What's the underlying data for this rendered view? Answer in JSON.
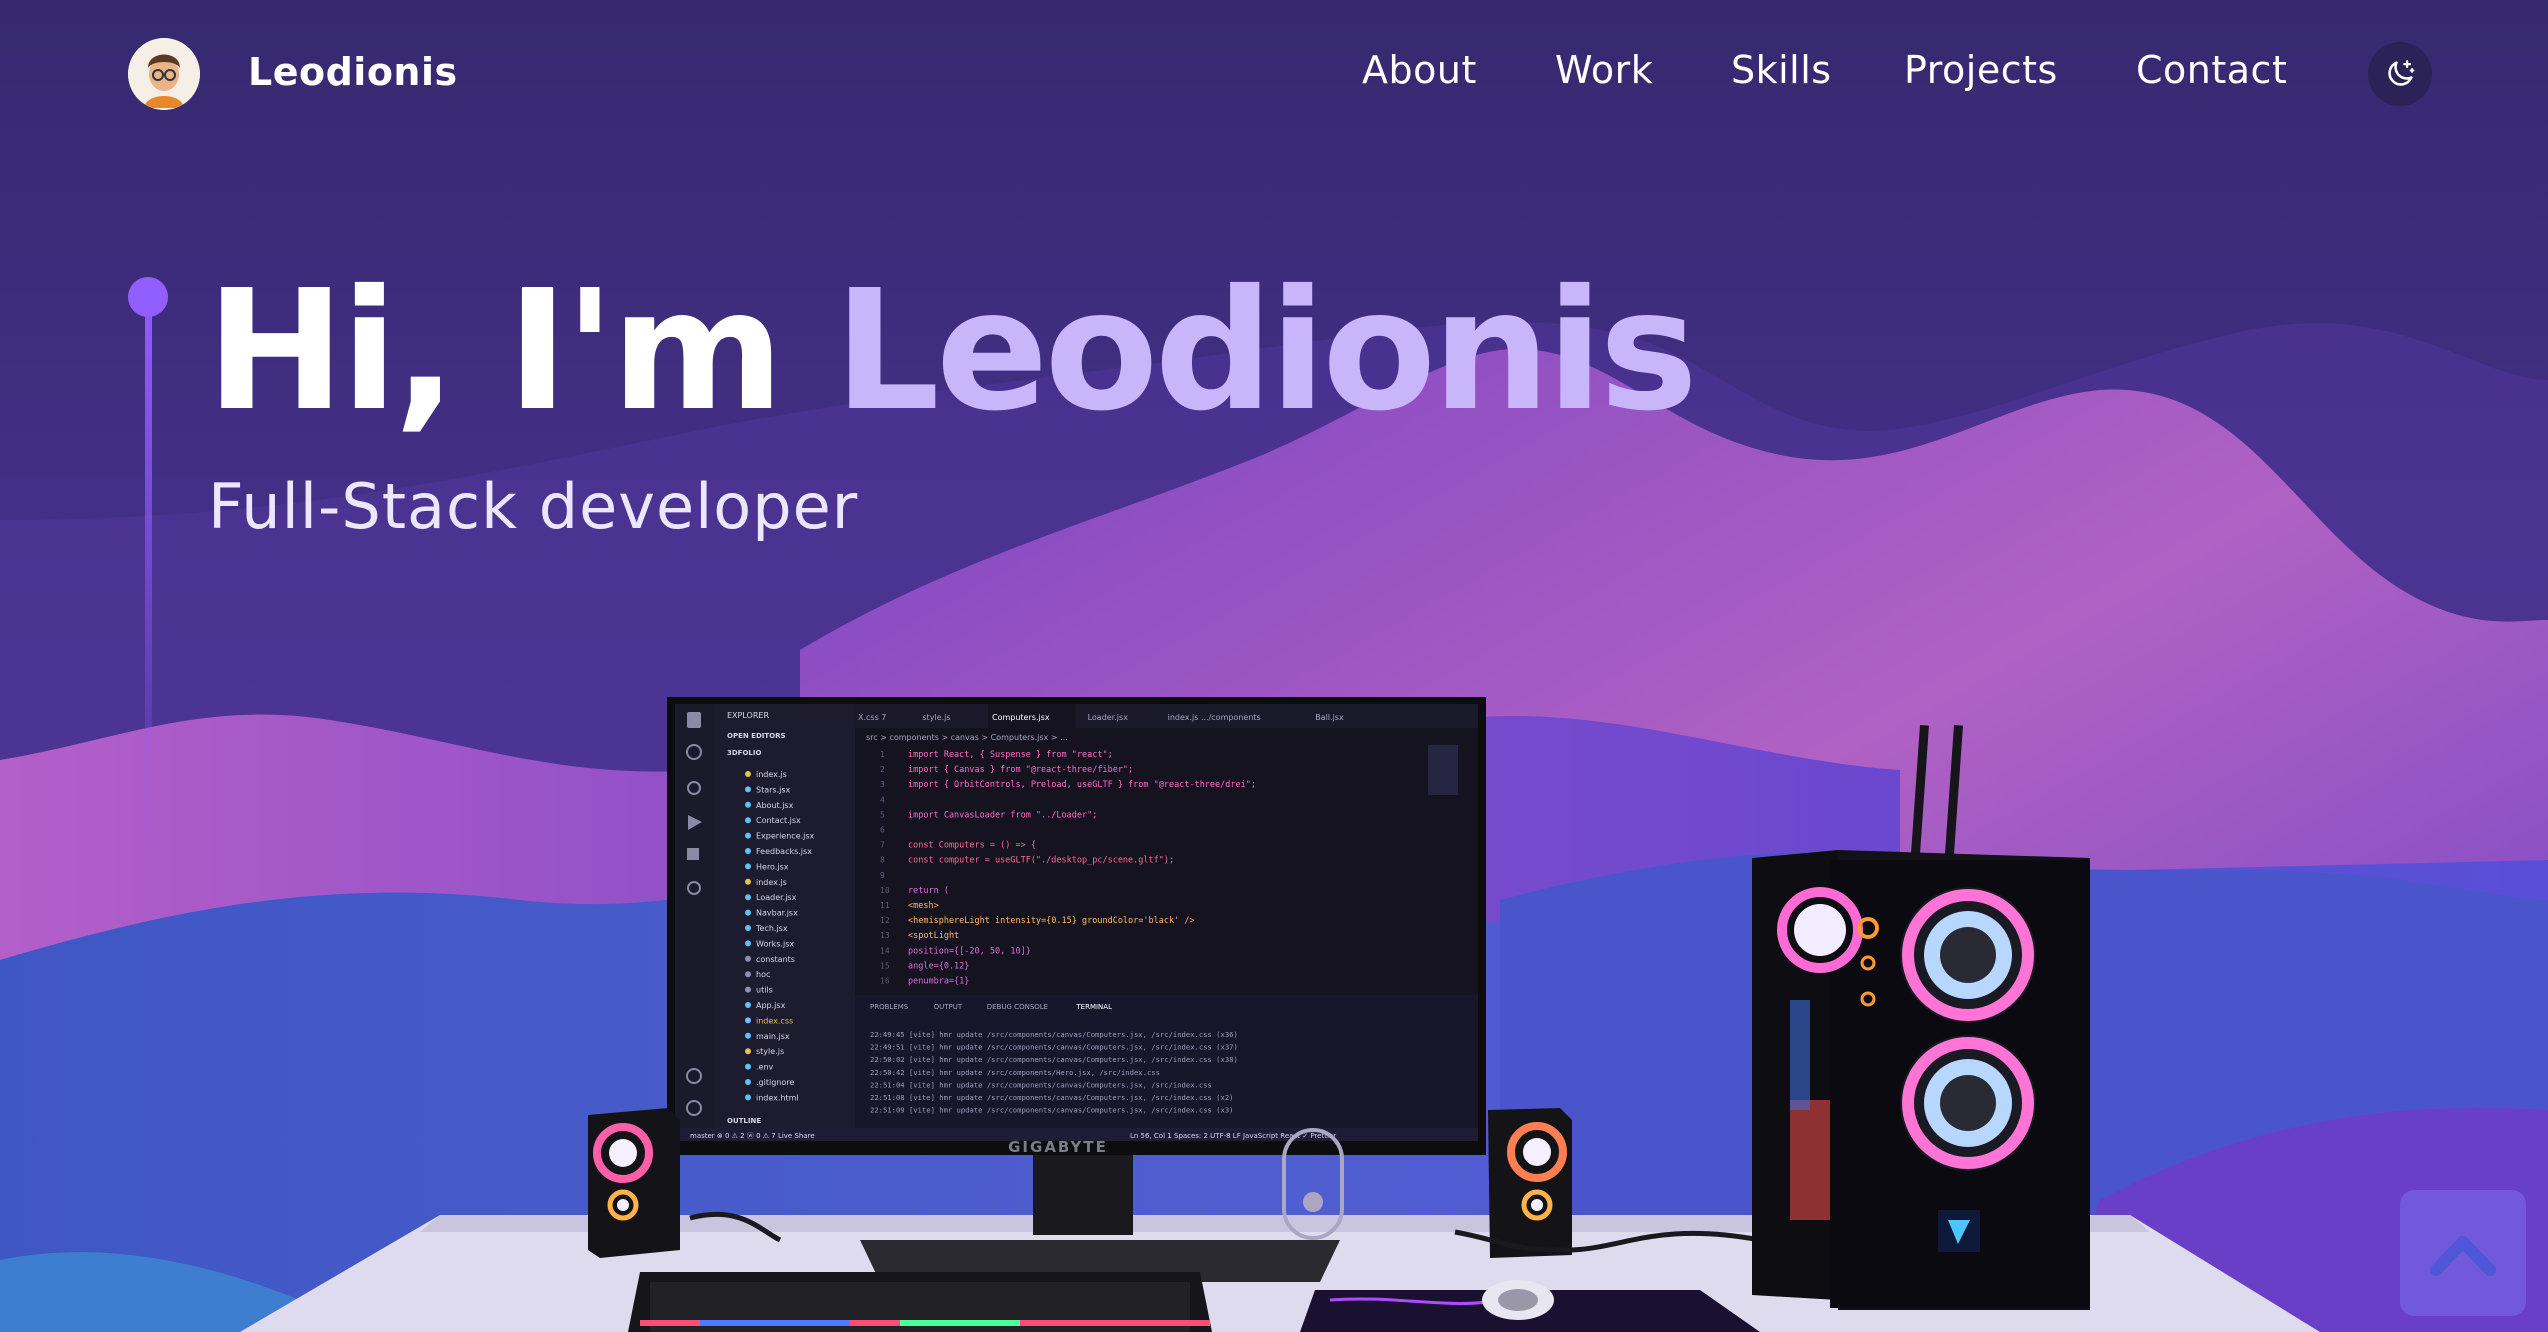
{
  "nav": {
    "brand": "Leodionis",
    "links": [
      {
        "label": "About"
      },
      {
        "label": "Work"
      },
      {
        "label": "Skills"
      },
      {
        "label": "Projects"
      },
      {
        "label": "Contact"
      }
    ],
    "theme_icon": "moon-stars-icon"
  },
  "hero": {
    "greeting": "Hi, I'm ",
    "name": "Leodionis",
    "subtitle": "Full-Stack developer"
  },
  "editor": {
    "explorer_title": "EXPLORER",
    "open_editors": "OPEN EDITORS",
    "project": "3DFOLIO",
    "tabs": [
      "X.css 7",
      "style.js",
      "Computers.jsx",
      "Loader.jsx",
      "index.js .../components",
      "Ball.jsx"
    ],
    "breadcrumb": "src > components > canvas > Computers.jsx > ...",
    "files": [
      "index.js",
      "Stars.jsx",
      "About.jsx",
      "Contact.jsx",
      "Experience.jsx",
      "Feedbacks.jsx",
      "Hero.jsx",
      "index.js",
      "Loader.jsx",
      "Navbar.jsx",
      "Tech.jsx",
      "Works.jsx",
      "constants",
      "hoc",
      "utils",
      "App.jsx",
      "index.css",
      "main.jsx",
      "style.js",
      ".env",
      ".gitignore",
      "index.html"
    ],
    "code_lines": [
      "import React, { Suspense } from \"react\";",
      "import { Canvas } from \"@react-three/fiber\";",
      "import { OrbitControls, Preload, useGLTF } from \"@react-three/drei\";",
      "",
      "import CanvasLoader from \"../Loader\";",
      "",
      "const Computers = () => {",
      "  const computer = useGLTF(\"./desktop_pc/scene.gltf\");",
      "",
      "  return (",
      "    <mesh>",
      "      <hemisphereLight intensity={0.15} groundColor='black' />",
      "      <spotLight",
      "        position={[-20, 50, 10]}",
      "        angle={0.12}",
      "        penumbra={1}"
    ],
    "panel_tabs": [
      "PROBLEMS",
      "OUTPUT",
      "DEBUG CONSOLE",
      "TERMINAL"
    ],
    "terminal_lines": [
      "22:49:45 [vite] hmr update /src/components/canvas/Computers.jsx, /src/index.css (x36)",
      "22:49:51 [vite] hmr update /src/components/canvas/Computers.jsx, /src/index.css (x37)",
      "22:50:02 [vite] hmr update /src/components/canvas/Computers.jsx, /src/index.css (x38)",
      "22:50:42 [vite] hmr update /src/components/Hero.jsx, /src/index.css",
      "22:51:04 [vite] hmr update /src/components/canvas/Computers.jsx, /src/index.css",
      "22:51:08 [vite] hmr update /src/components/canvas/Computers.jsx, /src/index.css (x2)",
      "22:51:09 [vite] hmr update /src/components/canvas/Computers.jsx, /src/index.css (x3)"
    ],
    "status_left": "master  ⊗ 0 ⚠ 2  ⓦ 0 ⚠ 7  Live Share",
    "status_right": "Ln 56, Col 1  Spaces: 2  UTF-8  LF  JavaScript React  ✓ Prettier",
    "outline": "OUTLINE"
  },
  "monitor_brand": "GIGABYTE",
  "colors": {
    "accent": "#915eff",
    "name": "#c9b5fa",
    "bg_top": "#362a73",
    "bg_mid": "#7a46c8"
  }
}
